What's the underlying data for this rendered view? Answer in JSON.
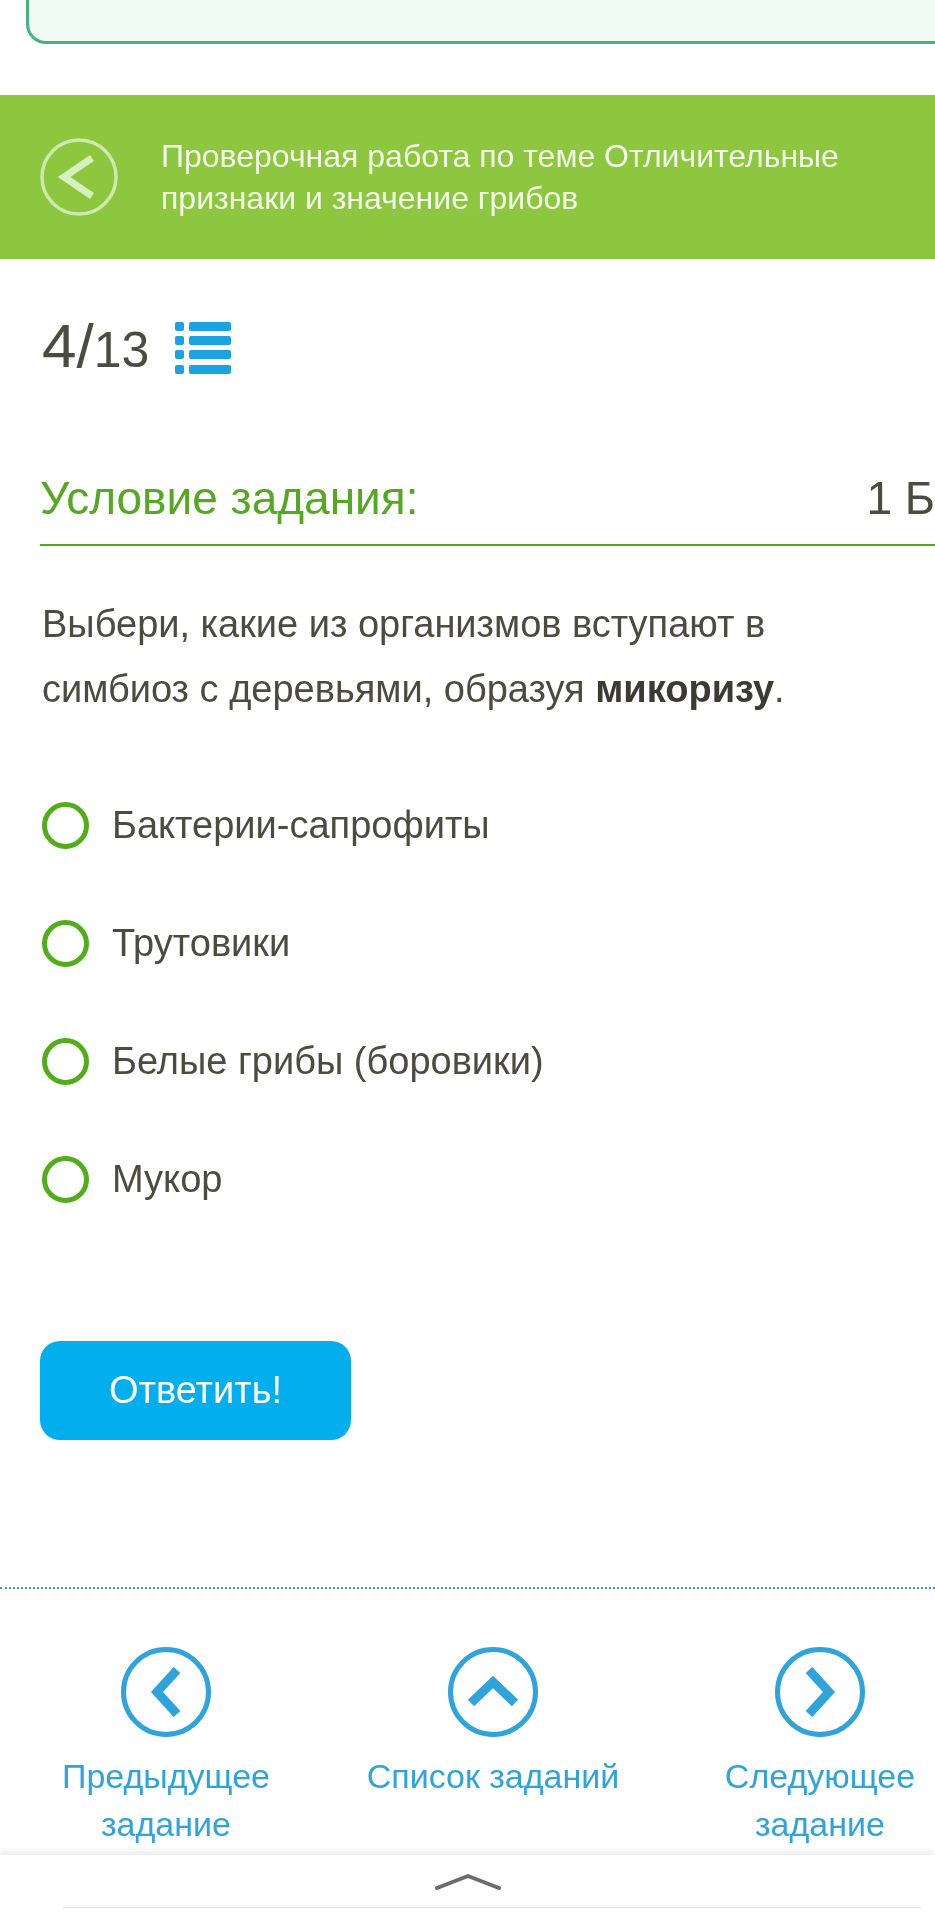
{
  "banner": {
    "title": "Проверочная работа по теме Отличительные признаки и значение грибов"
  },
  "progress": {
    "counter": "4/13"
  },
  "task": {
    "heading": "Условие задания:",
    "points": "1 Б",
    "question": "Выбери, какие из организмов вступают в симбиоз с деревьями, образуя **микоризу**.",
    "options": [
      {
        "label": "Бактерии-сапрофиты",
        "selected": false
      },
      {
        "label": "Трутовики",
        "selected": false
      },
      {
        "label": "Белые грибы (боровики)",
        "selected": false
      },
      {
        "label": "Мукор",
        "selected": false
      }
    ],
    "submit_button": "Ответить!"
  },
  "navigation": [
    {
      "kind": "previous",
      "label": "Предыдущее задание"
    },
    {
      "kind": "list",
      "label": "Список заданий"
    },
    {
      "kind": "next",
      "label": "Следующее задание"
    }
  ]
}
